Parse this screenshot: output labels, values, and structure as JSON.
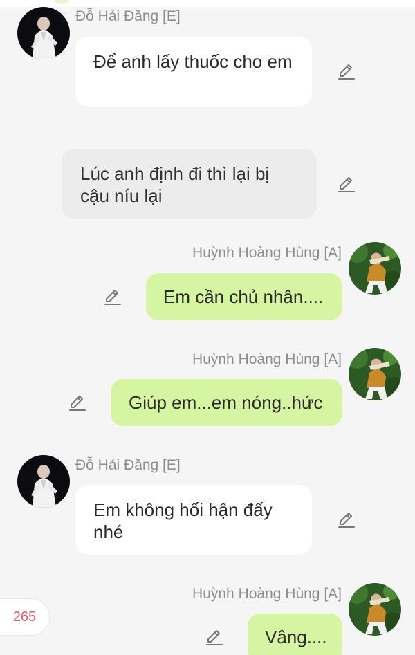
{
  "chat": {
    "participants": {
      "left": "Đỗ Hải Đăng [E]",
      "right": "Huỳnh Hoàng Hùng [A]"
    },
    "messages": [
      {
        "sender": "Đỗ Hải Đăng [E]",
        "side": "left",
        "style": "white",
        "text": "Để anh lấy thuốc cho em"
      },
      {
        "sender": "",
        "side": "center",
        "style": "grey",
        "text": "Lúc anh định đi thì lại bị cậu níu lại"
      },
      {
        "sender": "Huỳnh Hoàng Hùng [A]",
        "side": "right",
        "style": "green",
        "text": "Em cần chủ nhân...."
      },
      {
        "sender": "Huỳnh Hoàng Hùng [A]",
        "side": "right",
        "style": "green",
        "text": "Giúp em...em nóng..hức"
      },
      {
        "sender": "Đỗ Hải Đăng [E]",
        "side": "left",
        "style": "white",
        "text": "Em không hối hận đấy nhé"
      },
      {
        "sender": "Huỳnh Hoàng Hùng [A]",
        "side": "right",
        "style": "green",
        "text": "Vâng...."
      }
    ],
    "count_badge": "265"
  },
  "icons": {
    "edit": "pencil-icon",
    "avatar_left": "avatar-do-hai-dang",
    "avatar_right": "avatar-huynh-hoang-hung"
  },
  "colors": {
    "background": "#f5f5f5",
    "bubble_white": "#ffffff",
    "bubble_grey": "#ececec",
    "bubble_green": "#d6f5a2",
    "sender_name": "#8d8d8d",
    "count_badge_text": "#e25d6e"
  }
}
